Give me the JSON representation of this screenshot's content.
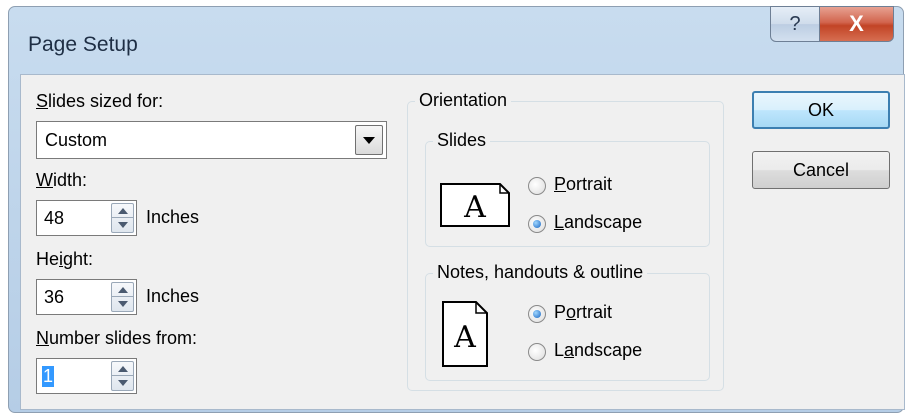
{
  "window": {
    "title": "Page Setup",
    "help_glyph": "?",
    "close_glyph": "X"
  },
  "left": {
    "slides_sized_for": {
      "label_u": "S",
      "label_rest": "lides sized for:",
      "value": "Custom"
    },
    "width": {
      "label_u": "W",
      "label_rest": "idth:",
      "value": "48",
      "unit": "Inches"
    },
    "height": {
      "label_pre": "He",
      "label_u": "i",
      "label_rest": "ght:",
      "value": "36",
      "unit": "Inches"
    },
    "number_from": {
      "label_u": "N",
      "label_rest": "umber slides from:",
      "value": "1"
    }
  },
  "orientation": {
    "title": "Orientation",
    "slides": {
      "title": "Slides",
      "icon_letter": "A",
      "portrait": {
        "u": "P",
        "rest": "ortrait",
        "selected": false
      },
      "landscape": {
        "u": "L",
        "rest": "andscape",
        "selected": true
      }
    },
    "notes": {
      "title": "Notes, handouts & outline",
      "icon_letter": "A",
      "portrait": {
        "pre": "P",
        "u": "o",
        "rest": "rtrait",
        "selected": true
      },
      "landscape": {
        "pre": "L",
        "u": "a",
        "rest": "ndscape",
        "selected": false
      }
    }
  },
  "buttons": {
    "ok": "OK",
    "cancel": "Cancel"
  },
  "icons": [
    "help-icon",
    "close-icon",
    "dropdown-arrow-icon",
    "spin-up-icon",
    "spin-down-icon",
    "landscape-page-icon",
    "portrait-page-icon"
  ]
}
